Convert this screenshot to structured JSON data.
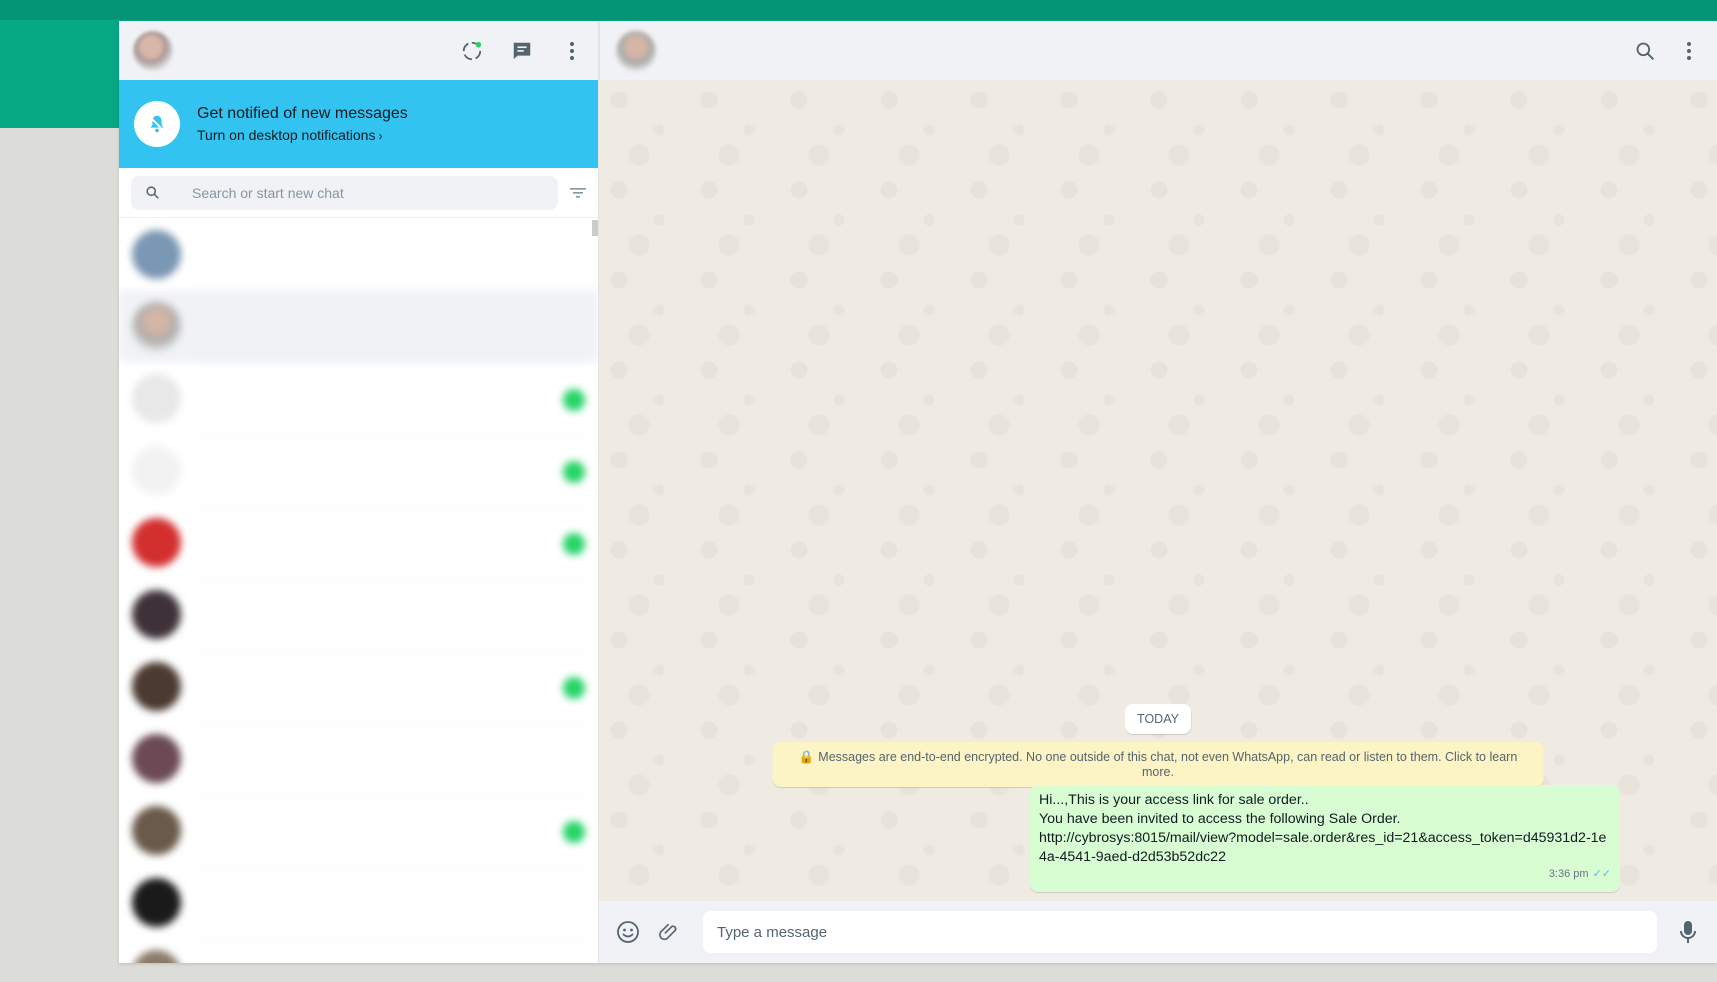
{
  "left": {
    "notification": {
      "title": "Get notified of new messages",
      "link": "Turn on desktop notifications",
      "chevron": "›"
    },
    "search": {
      "placeholder": "Search or start new chat"
    },
    "chats": [
      {
        "name": "",
        "time": "",
        "preview": ""
      },
      {
        "name": "",
        "time": "",
        "preview": ""
      },
      {
        "name": "",
        "time": "",
        "preview": ""
      },
      {
        "name": "",
        "time": "",
        "preview": ""
      },
      {
        "name": "",
        "time": "",
        "preview": ""
      },
      {
        "name": "",
        "time": "",
        "preview": ""
      },
      {
        "name": "",
        "time": "",
        "preview": ""
      },
      {
        "name": "",
        "time": "",
        "preview": ""
      },
      {
        "name": "",
        "time": "",
        "preview": ""
      },
      {
        "name": "",
        "time": "",
        "preview": ""
      },
      {
        "name": "",
        "time": "",
        "preview": ""
      }
    ]
  },
  "right": {
    "date_pill": "TODAY",
    "encryption_notice": "Messages are end-to-end encrypted. No one outside of this chat, not even WhatsApp, can read or listen to them. Click to learn more.",
    "message": {
      "line1": "Hi...,This is your access link for sale order..",
      "line2": "You have been invited to access the following Sale Order.",
      "line3": "http://cybrosys:8015/mail/view?model=sale.order&res_id=21&access_token=d45931d2-1e4a-4541-9aed-d2d53b52dc22",
      "time": "3:36 pm",
      "ticks": "✓✓"
    },
    "composer": {
      "placeholder": "Type a message"
    }
  },
  "colors": {
    "accent": "#06a884",
    "notification_bg": "#33c3f0",
    "outgoing_bubble": "#d9fdd3",
    "encryption_bg": "#fdf4c5"
  },
  "icons": [
    "status-icon",
    "new-chat-icon",
    "menu-icon",
    "bell-off-icon",
    "search-icon",
    "filter-icon",
    "emoji-icon",
    "attach-icon",
    "mic-icon"
  ]
}
